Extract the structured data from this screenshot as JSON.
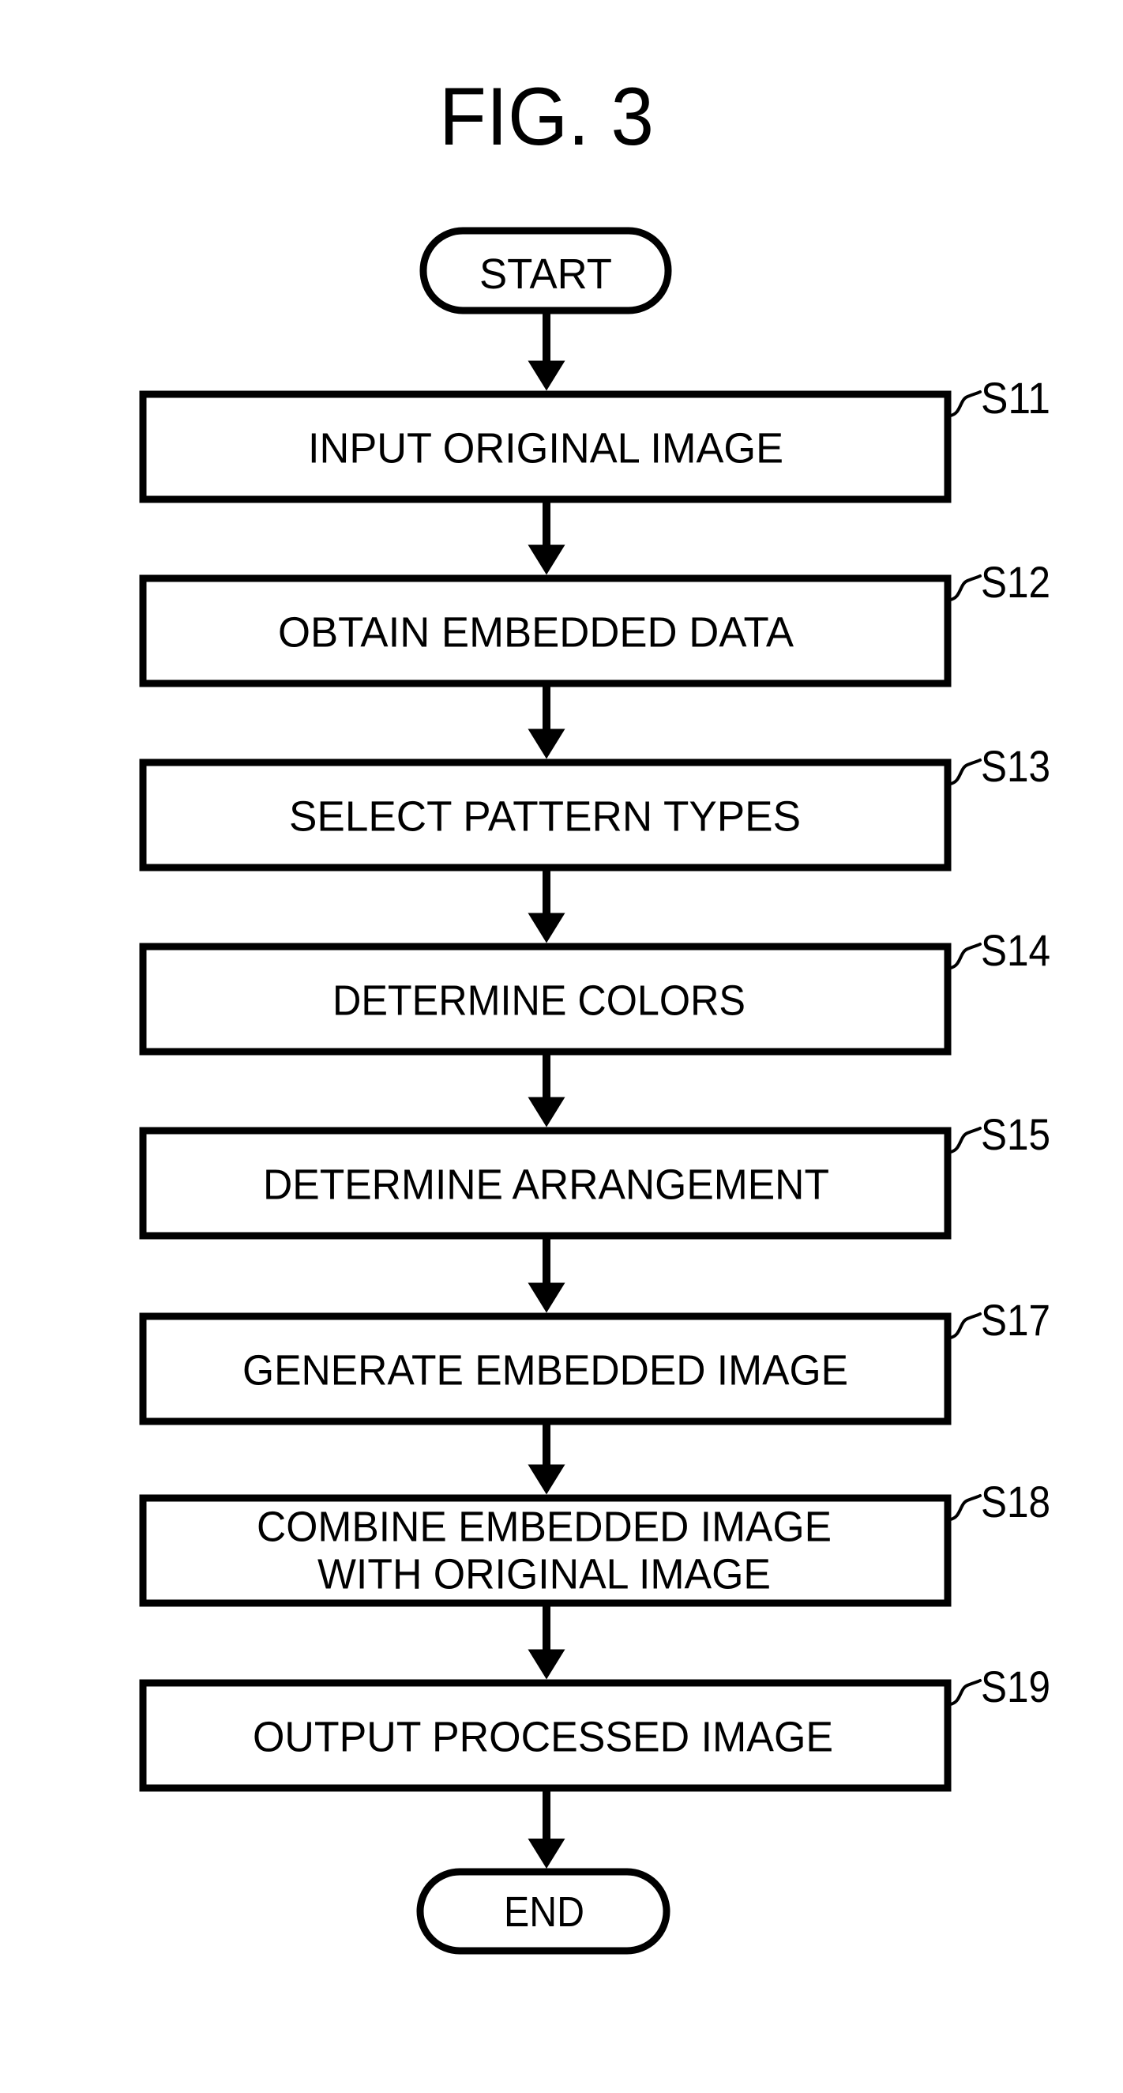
{
  "figure": {
    "title": "FIG. 3",
    "colors": {
      "ink": "#000000",
      "paper": "#ffffff"
    }
  },
  "flowchart": {
    "start": {
      "label": "START"
    },
    "end": {
      "label": "END"
    },
    "steps": [
      {
        "id": "S11",
        "lines": [
          "INPUT ORIGINAL IMAGE"
        ]
      },
      {
        "id": "S12",
        "lines": [
          "OBTAIN EMBEDDED DATA"
        ]
      },
      {
        "id": "S13",
        "lines": [
          "SELECT PATTERN TYPES"
        ]
      },
      {
        "id": "S14",
        "lines": [
          "DETERMINE COLORS"
        ]
      },
      {
        "id": "S15",
        "lines": [
          "DETERMINE ARRANGEMENT"
        ]
      },
      {
        "id": "S17",
        "lines": [
          "GENERATE EMBEDDED IMAGE"
        ]
      },
      {
        "id": "S18",
        "lines": [
          "COMBINE EMBEDDED IMAGE",
          "WITH ORIGINAL IMAGE"
        ]
      },
      {
        "id": "S19",
        "lines": [
          "OUTPUT PROCESSED IMAGE"
        ]
      }
    ]
  }
}
